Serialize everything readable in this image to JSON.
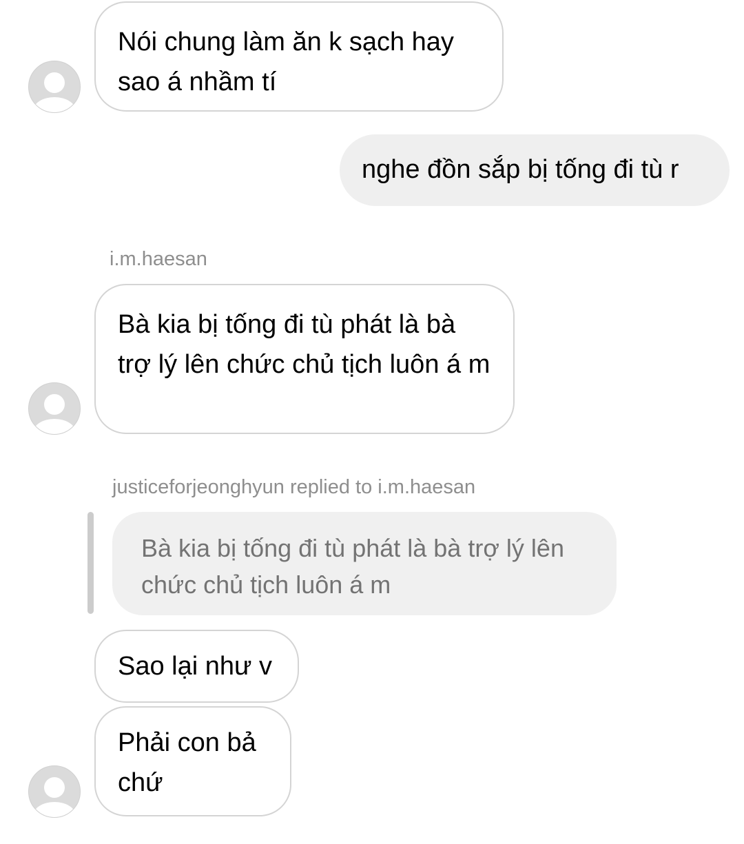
{
  "messages": [
    {
      "text": "Nói chung làm ăn k sạch hay sao á nhầm tí"
    },
    {
      "text": "nghe đồn sắp bị tống đi tù r"
    },
    {
      "text": "Bà kia bị tống đi tù phát là bà trợ lý lên chức chủ tịch luôn á m"
    },
    {
      "text": "Sao lại như v"
    },
    {
      "text": "Phải con bả chứ"
    }
  ],
  "sender_label": "i.m.haesan",
  "reply": {
    "label": "justiceforjeonghyun replied to i.m.haesan",
    "quoted_text": "Bà kia bị tống đi tù phát là bà trợ lý lên chức chủ tịch luôn á m"
  }
}
